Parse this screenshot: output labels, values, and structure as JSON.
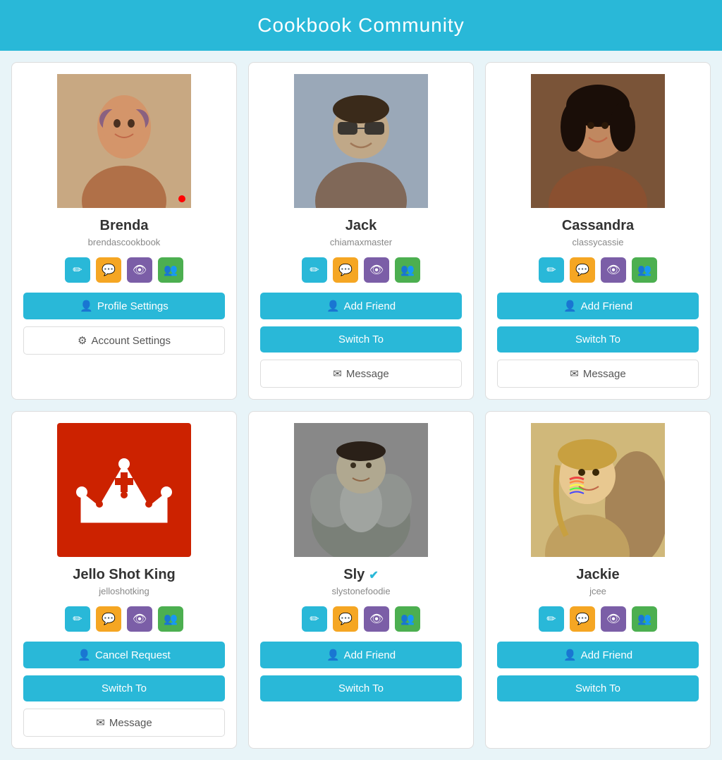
{
  "header": {
    "title": "Cookbook Community"
  },
  "users": [
    {
      "id": "brenda",
      "name": "Brenda",
      "handle": "brendascookbook",
      "verified": false,
      "photo_type": "brenda",
      "is_self": true,
      "has_red_dot": true,
      "buttons": [
        {
          "label": "Profile Settings",
          "type": "cyan",
          "icon": "person",
          "key": "profile-settings"
        },
        {
          "label": "Account Settings",
          "type": "white",
          "icon": "gear",
          "key": "account-settings"
        }
      ]
    },
    {
      "id": "jack",
      "name": "Jack",
      "handle": "chiamaxmaster",
      "verified": false,
      "photo_type": "jack",
      "is_self": false,
      "buttons": [
        {
          "label": "Add Friend",
          "type": "cyan",
          "icon": "person-add",
          "key": "add-friend"
        },
        {
          "label": "Switch To",
          "type": "cyan",
          "icon": "",
          "key": "switch-to"
        },
        {
          "label": "Message",
          "type": "white",
          "icon": "message",
          "key": "message"
        }
      ]
    },
    {
      "id": "cassandra",
      "name": "Cassandra",
      "handle": "classycassie",
      "verified": false,
      "photo_type": "cassandra",
      "is_self": false,
      "buttons": [
        {
          "label": "Add Friend",
          "type": "cyan",
          "icon": "person-add",
          "key": "add-friend"
        },
        {
          "label": "Switch To",
          "type": "cyan",
          "icon": "",
          "key": "switch-to"
        },
        {
          "label": "Message",
          "type": "white",
          "icon": "message",
          "key": "message"
        }
      ]
    },
    {
      "id": "jello-shot-king",
      "name": "Jello Shot King",
      "handle": "jelloshotking",
      "verified": false,
      "photo_type": "crown",
      "is_self": false,
      "buttons": [
        {
          "label": "Cancel Request",
          "type": "cyan",
          "icon": "person-add",
          "key": "cancel-request"
        },
        {
          "label": "Switch To",
          "type": "cyan",
          "icon": "",
          "key": "switch-to"
        },
        {
          "label": "Message",
          "type": "white",
          "icon": "message",
          "key": "message"
        }
      ]
    },
    {
      "id": "sly",
      "name": "Sly",
      "handle": "slystonefoodie",
      "verified": true,
      "photo_type": "sly",
      "is_self": false,
      "buttons": [
        {
          "label": "Add Friend",
          "type": "cyan",
          "icon": "person-add",
          "key": "add-friend"
        },
        {
          "label": "Switch To",
          "type": "cyan",
          "icon": "",
          "key": "switch-to"
        }
      ]
    },
    {
      "id": "jackie",
      "name": "Jackie",
      "handle": "jcee",
      "verified": false,
      "photo_type": "jackie",
      "is_self": false,
      "buttons": [
        {
          "label": "Add Friend",
          "type": "cyan",
          "icon": "person-add",
          "key": "add-friend"
        },
        {
          "label": "Switch To",
          "type": "cyan",
          "icon": "",
          "key": "switch-to"
        }
      ]
    }
  ],
  "icons": {
    "pencil": "✏",
    "chat": "💬",
    "eye": "👁",
    "group": "👥",
    "person": "👤",
    "gear": "⚙",
    "person_add": "👤+",
    "message": "✉",
    "checkmark": "✔"
  }
}
